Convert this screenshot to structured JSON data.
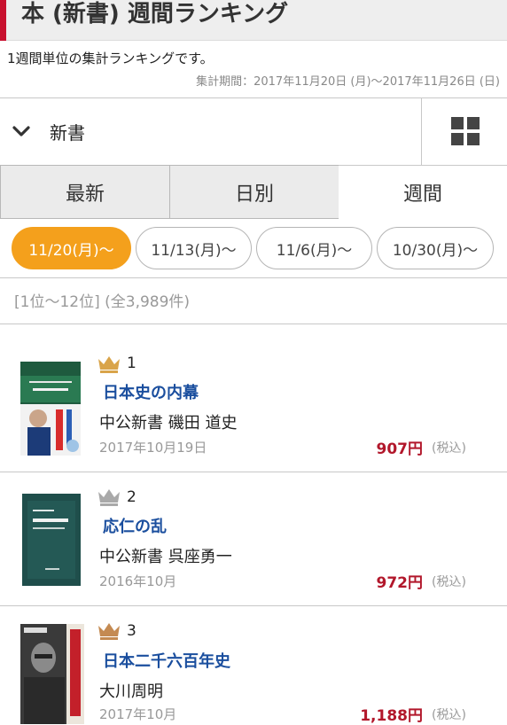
{
  "header": {
    "title": "本 (新書) 週間ランキング",
    "accent_color": "#c8102e"
  },
  "intro": {
    "description": "1週間単位の集計ランキングです。",
    "period": "集計期間：2017年11月20日 (月)～2017年11月26日 (日)"
  },
  "category": {
    "selected": "新書",
    "chevron_icon": "chevron-down-icon",
    "grid_icon": "grid-view-icon"
  },
  "tabs": [
    {
      "label": "最新",
      "active": false
    },
    {
      "label": "日別",
      "active": false
    },
    {
      "label": "週間",
      "active": true
    }
  ],
  "weeks": [
    {
      "label": "11/20(月)～",
      "active": true
    },
    {
      "label": "11/13(月)～",
      "active": false
    },
    {
      "label": "11/6(月)～",
      "active": false
    },
    {
      "label": "10/30(月)～",
      "active": false
    }
  ],
  "result_count": "[1位～12位] (全3,989件)",
  "items": [
    {
      "rank": "1",
      "crown": "gold-crown-icon",
      "title": "日本史の内幕",
      "publisher_author": "中公新書 磯田 道史",
      "date": "2017年10月19日",
      "price": "907円",
      "tax": "(税込)"
    },
    {
      "rank": "2",
      "crown": "silver-crown-icon",
      "title": "応仁の乱",
      "publisher_author": "中公新書 呉座勇一",
      "date": "2016年10月",
      "price": "972円",
      "tax": "(税込)"
    },
    {
      "rank": "3",
      "crown": "bronze-crown-icon",
      "title": "日本二千六百年史",
      "publisher_author": "大川周明",
      "date": "2017年10月",
      "price": "1,188円",
      "tax": "(税込)"
    }
  ],
  "colors": {
    "active_week": "#f4a01c",
    "price": "#b2172b",
    "title_link": "#1a4e9e",
    "gold": "#d9a44a",
    "silver": "#a9a9a9",
    "bronze": "#c48a52"
  }
}
